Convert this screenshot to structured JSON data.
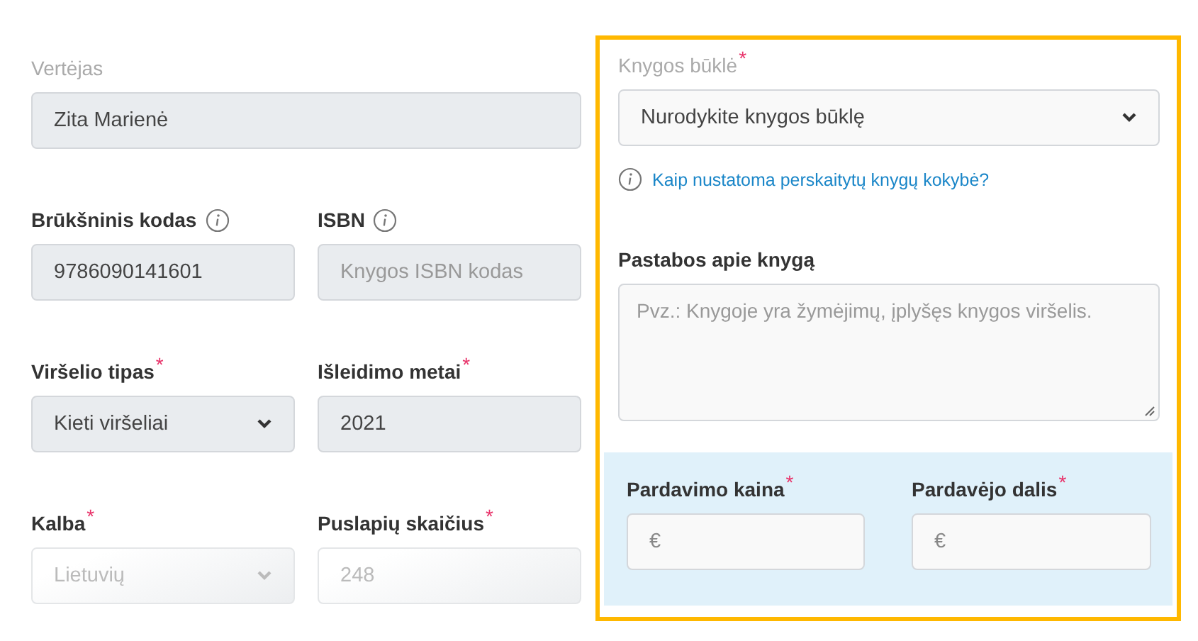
{
  "left_fields": [
    {
      "label": "Vertėjas",
      "muted": true,
      "kind": "input",
      "value": "Zita Marienė",
      "readonly": true,
      "disabled": false,
      "info": false,
      "wide": true
    },
    {
      "label": "Brūkšninis kodas",
      "muted": false,
      "kind": "input",
      "value": "9786090141601",
      "readonly": true,
      "disabled": false,
      "info": true,
      "wide": false
    },
    {
      "label": "ISBN",
      "muted": false,
      "kind": "input",
      "placeholder": "Knygos ISBN kodas",
      "readonly": true,
      "disabled": false,
      "info": true,
      "wide": false
    },
    {
      "label": "Viršelio tipas",
      "mark": "*",
      "muted": false,
      "kind": "select",
      "value": "Kieti viršeliai",
      "readonly": true,
      "disabled": false,
      "info": false,
      "wide": false
    },
    {
      "label": "Išleidimo metai",
      "mark": "*",
      "muted": false,
      "kind": "input",
      "value": "2021",
      "readonly": true,
      "disabled": false,
      "info": false,
      "wide": false
    },
    {
      "label": "Kalba",
      "mark": "*",
      "muted": false,
      "kind": "select",
      "value": "Lietuvių",
      "readonly": true,
      "disabled": true,
      "info": false,
      "wide": false
    },
    {
      "label": "Puslapių skaičius",
      "mark": "*",
      "muted": false,
      "kind": "input",
      "value": "248",
      "readonly": true,
      "disabled": true,
      "info": false,
      "wide": false
    }
  ],
  "condition": {
    "label": "Knygos būklė",
    "mark": "*",
    "muted": true,
    "kind": "select",
    "value": "Nurodykite knygos būklę",
    "readonly": false,
    "disabled": false,
    "info": false
  },
  "help_link": "Kaip nustatoma perskaitytų knygų kokybė?",
  "notes": {
    "label": "Pastabos apie knygą",
    "muted": false,
    "kind": "textarea",
    "placeholder": "Pvz.: Knygoje yra žymėjimų, įplyšęs knygos viršelis.",
    "readonly": false,
    "disabled": false,
    "info": false
  },
  "price_fields": [
    {
      "label": "Pardavimo kaina",
      "mark": "*",
      "muted": false,
      "kind": "input",
      "prefix": "€",
      "readonly": false,
      "disabled": false,
      "info": false
    },
    {
      "label": "Pardavėjo dalis",
      "mark": "*",
      "muted": false,
      "kind": "input",
      "prefix": "€",
      "readonly": false,
      "disabled": false,
      "info": false
    }
  ]
}
